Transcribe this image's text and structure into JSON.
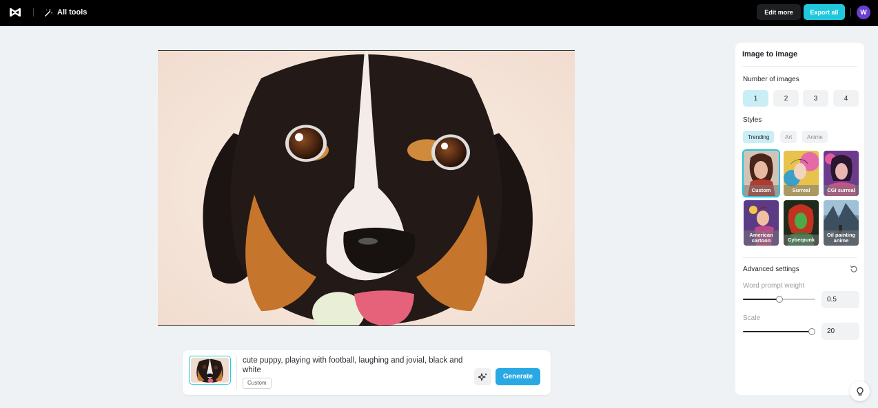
{
  "topbar": {
    "all_tools_label": "All tools",
    "edit_more_label": "Edit more",
    "export_all_label": "Export all",
    "avatar_initial": "W"
  },
  "colors": {
    "accent": "#21c8dd",
    "generate": "#2aa8e4",
    "avatar": "#6c3fd1"
  },
  "prompt": {
    "text": "cute puppy, playing with football, laughing and jovial, black and white",
    "style_tag": "Custom",
    "generate_label": "Generate"
  },
  "panel": {
    "title": "Image to image",
    "number_label": "Number of images",
    "number_options": [
      "1",
      "2",
      "3",
      "4"
    ],
    "selected_number": "1",
    "styles_label": "Styles",
    "style_tabs": [
      "Trending",
      "Art",
      "Anime"
    ],
    "active_tab": "Trending",
    "styles": [
      {
        "label": "Custom",
        "selected": true
      },
      {
        "label": "Surreal",
        "selected": false
      },
      {
        "label": "CGI surreal",
        "selected": false
      },
      {
        "label": "American cartoon",
        "selected": false
      },
      {
        "label": "Cyberpunk",
        "selected": false
      },
      {
        "label": "Oil painting anime",
        "selected": false
      }
    ],
    "advanced_label": "Advanced settings",
    "word_weight_label": "Word prompt weight",
    "word_weight_value": "0.5",
    "word_weight_fraction": 0.5,
    "scale_label": "Scale",
    "scale_value": "20",
    "scale_fraction": 1.0
  },
  "icons": [
    "capcut-logo-icon",
    "magic-wand-icon",
    "sparkle-icon",
    "reset-icon",
    "lightbulb-icon"
  ]
}
